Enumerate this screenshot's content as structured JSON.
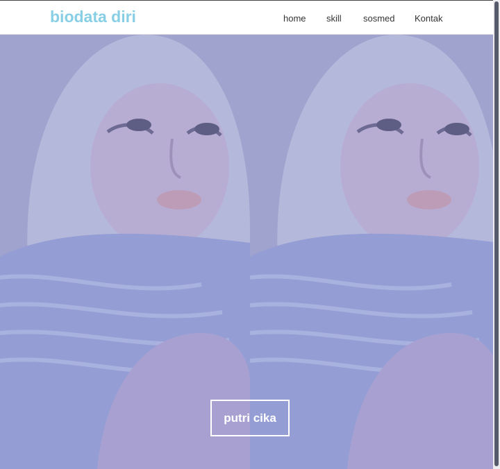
{
  "brand": {
    "title": "biodata diri"
  },
  "nav": {
    "home": "home",
    "skill": "skill",
    "sosmed": "sosmed",
    "kontak": "Kontak"
  },
  "hero": {
    "name": "putri cika"
  },
  "colors": {
    "brand": "#88cfe6",
    "overlay": "#8f96cc",
    "text_light": "#ffffff"
  },
  "icons": {
    "photo": "portrait-photo"
  }
}
